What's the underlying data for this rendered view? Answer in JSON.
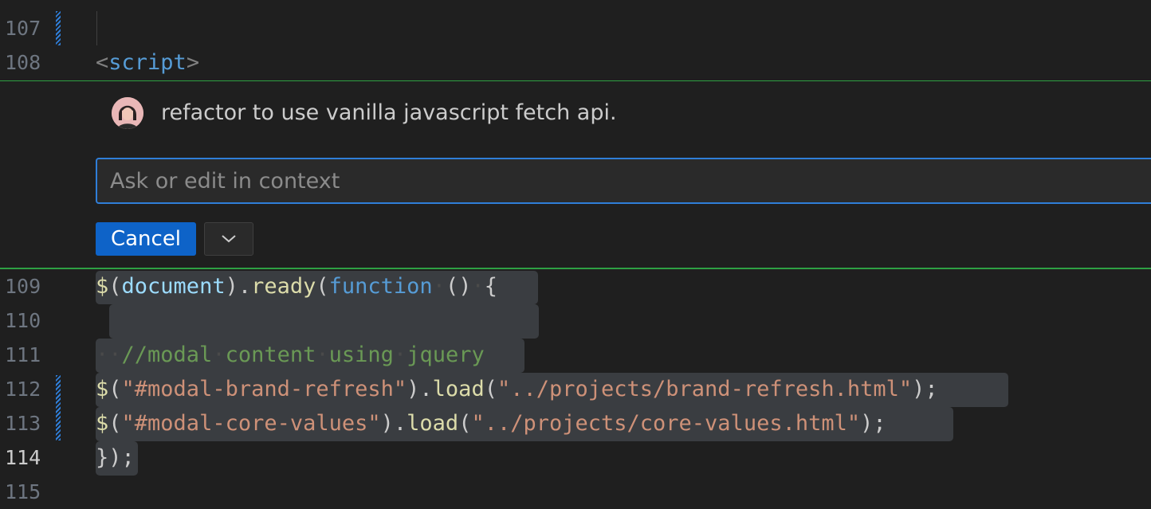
{
  "editor": {
    "lines": [
      {
        "number": "107",
        "tokens": []
      },
      {
        "number": "108",
        "tokens": [
          {
            "text": "<",
            "cls": "tok-bracket"
          },
          {
            "text": "script",
            "cls": "tok-tag"
          },
          {
            "text": ">",
            "cls": "tok-bracket"
          }
        ]
      },
      {
        "number": "109",
        "tokens": [
          {
            "text": "$",
            "cls": "tok-fn"
          },
          {
            "text": "(",
            "cls": "tok-punct"
          },
          {
            "text": "document",
            "cls": "tok-var"
          },
          {
            "text": ").",
            "cls": "tok-punct"
          },
          {
            "text": "ready",
            "cls": "tok-fn"
          },
          {
            "text": "(",
            "cls": "tok-punct"
          },
          {
            "text": "function",
            "cls": "tok-kw"
          },
          {
            "text": "·",
            "cls": "tok-ws"
          },
          {
            "text": "()",
            "cls": "tok-punct"
          },
          {
            "text": "·",
            "cls": "tok-ws"
          },
          {
            "text": "{",
            "cls": "tok-punct"
          }
        ]
      },
      {
        "number": "110",
        "tokens": []
      },
      {
        "number": "111",
        "tokens": [
          {
            "text": "··",
            "cls": "tok-ws"
          },
          {
            "text": "//modal",
            "cls": "tok-comment"
          },
          {
            "text": "·",
            "cls": "tok-ws"
          },
          {
            "text": "content",
            "cls": "tok-comment"
          },
          {
            "text": "·",
            "cls": "tok-ws"
          },
          {
            "text": "using",
            "cls": "tok-comment"
          },
          {
            "text": "·",
            "cls": "tok-ws"
          },
          {
            "text": "jquery",
            "cls": "tok-comment"
          }
        ]
      },
      {
        "number": "112",
        "tokens": [
          {
            "text": "$",
            "cls": "tok-fn"
          },
          {
            "text": "(",
            "cls": "tok-punct"
          },
          {
            "text": "\"#modal-brand-refresh\"",
            "cls": "tok-str"
          },
          {
            "text": ").",
            "cls": "tok-punct"
          },
          {
            "text": "load",
            "cls": "tok-fn"
          },
          {
            "text": "(",
            "cls": "tok-punct"
          },
          {
            "text": "\"../projects/brand-refresh.html\"",
            "cls": "tok-str"
          },
          {
            "text": ");",
            "cls": "tok-punct"
          }
        ]
      },
      {
        "number": "113",
        "tokens": [
          {
            "text": "$",
            "cls": "tok-fn"
          },
          {
            "text": "(",
            "cls": "tok-punct"
          },
          {
            "text": "\"#modal-core-values\"",
            "cls": "tok-str"
          },
          {
            "text": ").",
            "cls": "tok-punct"
          },
          {
            "text": "load",
            "cls": "tok-fn"
          },
          {
            "text": "(",
            "cls": "tok-punct"
          },
          {
            "text": "\"../projects/core-values.html\"",
            "cls": "tok-str"
          },
          {
            "text": ");",
            "cls": "tok-punct"
          }
        ]
      },
      {
        "number": "114",
        "tokens": [
          {
            "text": "});",
            "cls": "tok-punct"
          }
        ]
      },
      {
        "number": "115",
        "tokens": []
      }
    ]
  },
  "inline_chat": {
    "request_text": "refactor to use vanilla javascript fetch api.",
    "input_placeholder": "Ask or edit in context",
    "input_value": "",
    "cancel_label": "Cancel",
    "dropdown_icon": "chevron-down-icon"
  },
  "colors": {
    "accent_border": "#2f7ed8",
    "primary_button": "#0e63c8",
    "zone_border": "#2ea043"
  }
}
